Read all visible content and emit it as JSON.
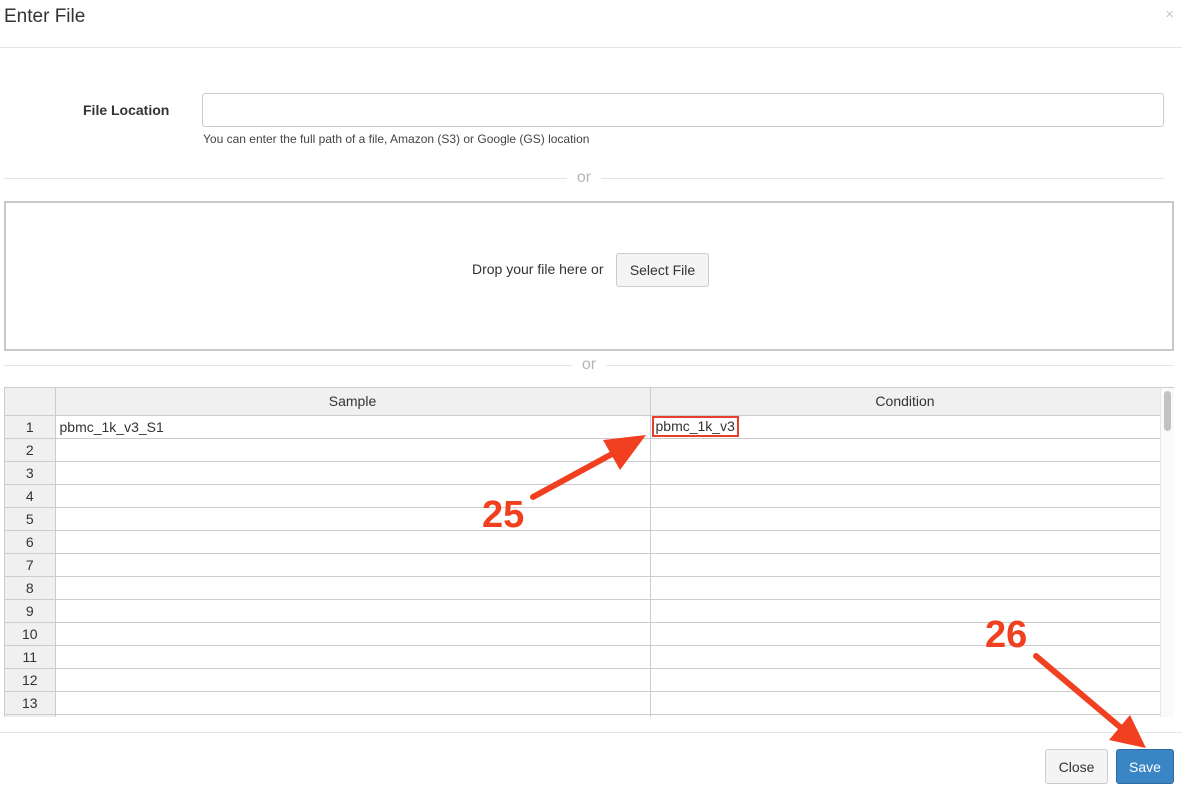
{
  "dialog": {
    "title": "Enter File",
    "close_glyph": "×"
  },
  "file_location": {
    "label": "File Location",
    "value": "",
    "placeholder": "",
    "help_text": "You can enter the full path of a file, Amazon (S3) or Google (GS) location"
  },
  "separators": {
    "or_text": "or"
  },
  "dropzone": {
    "text": "Drop your file here or",
    "select_button": "Select File"
  },
  "grid": {
    "columns": [
      "Sample",
      "Condition"
    ],
    "rows": [
      {
        "num": "1",
        "sample": "pbmc_1k_v3_S1",
        "condition": "pbmc_1k_v3"
      },
      {
        "num": "2",
        "sample": "",
        "condition": ""
      },
      {
        "num": "3",
        "sample": "",
        "condition": ""
      },
      {
        "num": "4",
        "sample": "",
        "condition": ""
      },
      {
        "num": "5",
        "sample": "",
        "condition": ""
      },
      {
        "num": "6",
        "sample": "",
        "condition": ""
      },
      {
        "num": "7",
        "sample": "",
        "condition": ""
      },
      {
        "num": "8",
        "sample": "",
        "condition": ""
      },
      {
        "num": "9",
        "sample": "",
        "condition": ""
      },
      {
        "num": "10",
        "sample": "",
        "condition": ""
      },
      {
        "num": "11",
        "sample": "",
        "condition": ""
      },
      {
        "num": "12",
        "sample": "",
        "condition": ""
      },
      {
        "num": "13",
        "sample": "",
        "condition": ""
      },
      {
        "num": "",
        "sample": "",
        "condition": ""
      }
    ]
  },
  "footer": {
    "close_label": "Close",
    "save_label": "Save"
  },
  "annotations": {
    "step_25": "25",
    "step_26": "26",
    "color": "#f0401f"
  },
  "colors": {
    "primary": "#3a86c5",
    "highlight": "#e4402b"
  }
}
